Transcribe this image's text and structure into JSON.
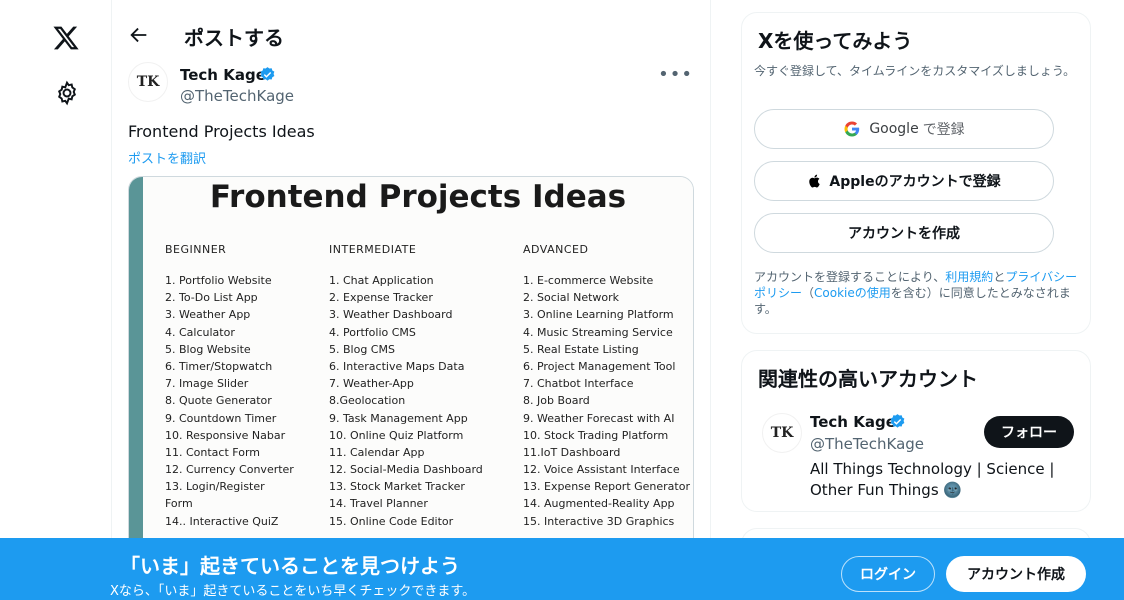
{
  "nav": {
    "logo_icon": "x-logo-icon",
    "settings_icon": "gear-icon"
  },
  "header": {
    "title": "ポストする",
    "back_icon": "arrow-left-icon"
  },
  "post": {
    "author_name": "Tech Kage",
    "author_handle": "@TheTechKage",
    "avatar_text": "TK",
    "more_icon": "more-dots-icon",
    "more_text": "•••",
    "text": "Frontend Projects Ideas",
    "translate": "ポストを翻訳",
    "image": {
      "title": "Frontend Projects Ideas",
      "beginner": {
        "head": "BEGINNER",
        "items": [
          "1. Portfolio Website",
          "2. To-Do List App",
          "3. Weather App",
          "4. Calculator",
          "5. Blog Website",
          "6. Timer/Stopwatch",
          "7. Image Slider",
          "8. Quote Generator",
          "9. Countdown Timer",
          "10. Responsive Nabar",
          "11. Contact Form",
          "12. Currency Converter",
          "13. Login/Register",
          "Form",
          "14.. Interactive QuiZ"
        ]
      },
      "intermediate": {
        "head": "INTERMEDIATE",
        "items": [
          "1. Chat Application",
          "2. Expense Tracker",
          "3. Weather Dashboard",
          "4. Portfolio CMS",
          "5. Blog CMS",
          "6. Interactive Maps Data",
          "7. Weather-App",
          "8.Geolocation",
          "9. Task Management App",
          "10. Online Quiz Platform",
          "11. Calendar App",
          "12. Social-Media Dashboard",
          "13. Stock Market Tracker",
          "14. Travel Planner",
          "15. Online Code Editor"
        ]
      },
      "advanced": {
        "head": "ADVANCED",
        "items": [
          "1. E-commerce Website",
          "2. Social Network",
          "3. Online Learning Platform",
          "4. Music Streaming Service",
          "5. Real Estate Listing",
          "6. Project Management Tool",
          "7. Chatbot Interface",
          "8. Job Board",
          "9. Weather Forecast with AI",
          "10. Stock Trading Platform",
          "11.IoT Dashboard",
          "12. Voice Assistant Interface",
          "13. Expense Report Generator",
          "14. Augmented-Reality App",
          "15. Interactive 3D Graphics"
        ]
      }
    }
  },
  "signup_card": {
    "title": "Xを使ってみよう",
    "subtitle": "今すぐ登録して、タイムラインをカスタマイズしましょう。",
    "google_label": "Google",
    "google_suffix": "で登録",
    "apple_label": "Appleのアカウントで登録",
    "create_label": "アカウントを作成",
    "legal_prefix": "アカウントを登録することにより、",
    "terms_link": "利用規約",
    "and": "と",
    "privacy_link": "プライバシーポリシー",
    "paren_open": "（",
    "cookie_link": "Cookieの使用",
    "legal_suffix": "を含む）に同意したとみなされます。"
  },
  "relevant": {
    "title": "関連性の高いアカウント",
    "name": "Tech Kage",
    "handle": "@TheTechKage",
    "bio": "All Things Technology | Science | Other Fun Things 🌚",
    "follow_label": "フォロー"
  },
  "banner": {
    "title": "「いま」起きていることを見つけよう",
    "subtitle": "Xなら、「いま」起きていることをいち早くチェックできます。",
    "login_label": "ログイン",
    "signup_label": "アカウント作成"
  },
  "colors": {
    "accent": "#1d9bf0",
    "text": "#0f1419",
    "muted": "#536471"
  }
}
